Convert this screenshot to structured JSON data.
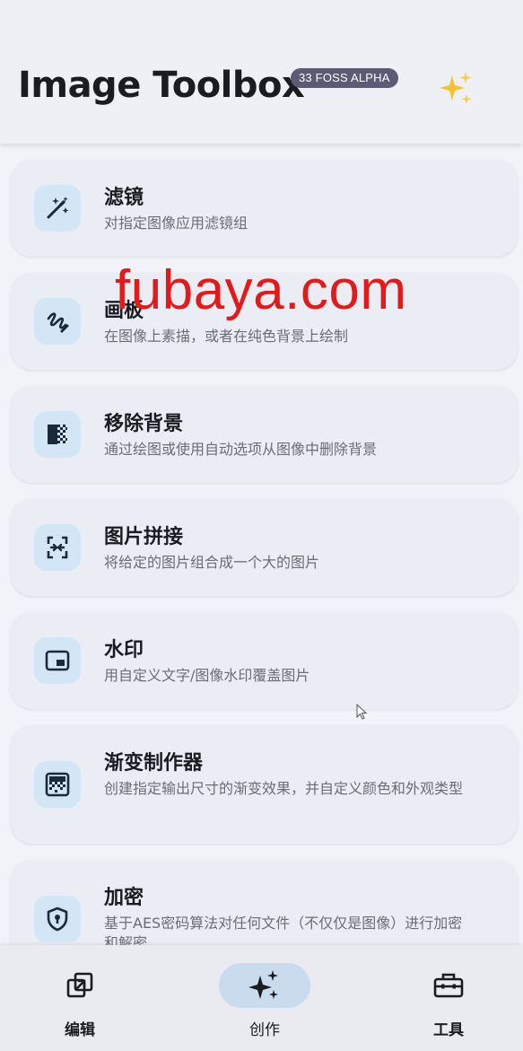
{
  "header": {
    "title": "Image Toolbox",
    "badge": "33 FOSS  ALPHA",
    "sparkle_icon": "sparkles-icon"
  },
  "watermark": "fubaya.com",
  "tools": [
    {
      "title": "滤镜",
      "desc": "对指定图像应用滤镜组",
      "icon": "magic-wand-icon"
    },
    {
      "title": "画板",
      "desc": "在图像上素描，或者在纯色背景上绘制",
      "icon": "draw-icon"
    },
    {
      "title": "移除背景",
      "desc": "通过绘图或使用自动选项从图像中删除背景",
      "icon": "remove-background-icon"
    },
    {
      "title": "图片拼接",
      "desc": "将给定的图片组合成一个大的图片",
      "icon": "stitch-icon"
    },
    {
      "title": "水印",
      "desc": "用自定义文字/图像水印覆盖图片",
      "icon": "watermark-icon"
    },
    {
      "title": "渐变制作器",
      "desc": "创建指定输出尺寸的渐变效果，并自定义颜色和外观类型",
      "icon": "gradient-icon"
    },
    {
      "title": "加密",
      "desc": "基于AES密码算法对任何文件（不仅仅是图像）进行加密和解密",
      "icon": "shield-key-icon"
    }
  ],
  "nav": {
    "edit": "编辑",
    "create": "创作",
    "tools": "工具",
    "active": "create"
  },
  "colors": {
    "accent": "#c8dcee",
    "icon_bg": "#d3e6f5",
    "badge": "#5d5a76",
    "watermark": "#e3191a"
  }
}
